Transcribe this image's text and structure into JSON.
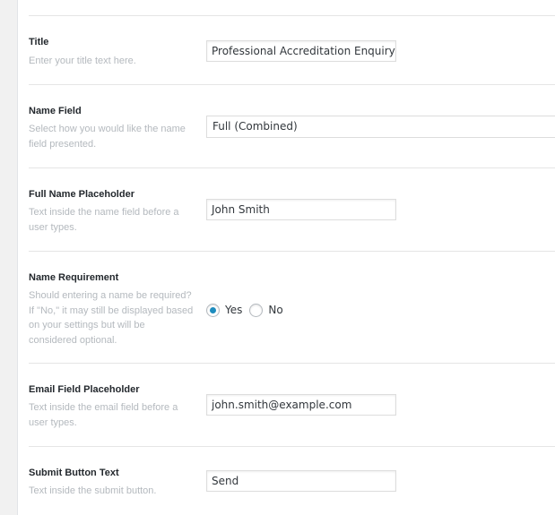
{
  "form_settings": {
    "title": {
      "label": "Title",
      "description": "Enter your title text here.",
      "value": "Professional Accreditation Enquiry"
    },
    "name_field": {
      "label": "Name Field",
      "description": "Select how you would like the name field presented.",
      "selected": "Full (Combined)"
    },
    "full_name_placeholder": {
      "label": "Full Name Placeholder",
      "description": "Text inside the name field before a user types.",
      "value": "John Smith"
    },
    "name_requirement": {
      "label": "Name Requirement",
      "description": "Should entering a name be required? If \"No,\" it may still be displayed based on your settings but will be considered optional.",
      "options": [
        "Yes",
        "No"
      ],
      "selected": "Yes"
    },
    "email_placeholder": {
      "label": "Email Field Placeholder",
      "description": "Text inside the email field before a user types.",
      "value": "john.smith@example.com"
    },
    "submit_text": {
      "label": "Submit Button Text",
      "description": "Text inside the submit button.",
      "value": "Send"
    }
  },
  "colors": {
    "radio_selected": "#1e8cbe",
    "description_text": "#b4b9be",
    "label_text": "#23282d"
  }
}
